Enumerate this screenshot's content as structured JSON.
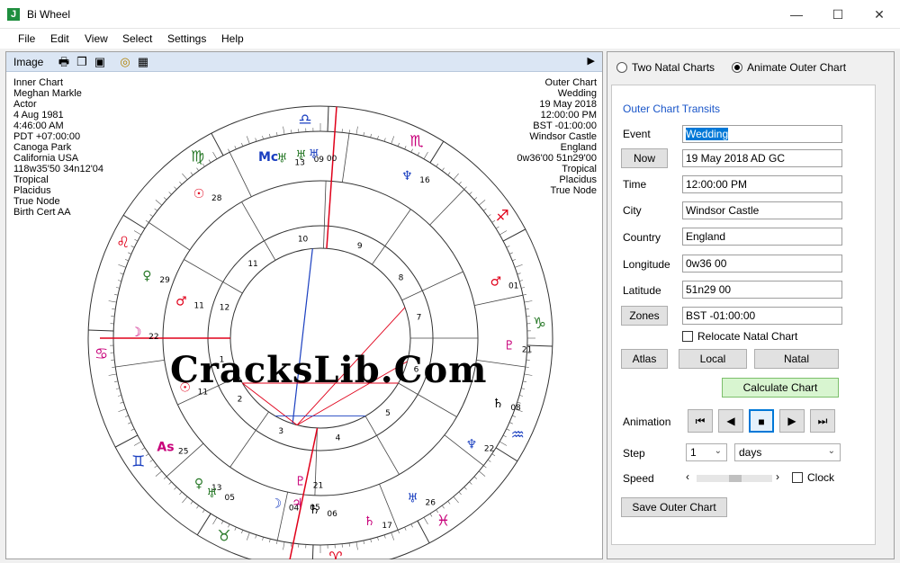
{
  "window": {
    "icon": "J",
    "title": "Bi Wheel",
    "minimize": "—",
    "maximize": "☐",
    "close": "✕"
  },
  "menu": [
    "File",
    "Edit",
    "View",
    "Select",
    "Settings",
    "Help"
  ],
  "toolbar": {
    "label": "Image",
    "icons": [
      "print-icon",
      "copy-icon",
      "save-image-icon",
      "target-icon",
      "grid-icon"
    ],
    "expand": "▶"
  },
  "inner_chart": [
    "Inner Chart",
    "Meghan Markle",
    "Actor",
    "4 Aug 1981",
    "4:46:00 AM",
    "PDT +07:00:00",
    "Canoga Park",
    "California USA",
    "118w35'50 34n12'04",
    "Tropical",
    "Placidus",
    "True Node",
    "Birth Cert AA"
  ],
  "outer_chart": [
    "Outer Chart",
    "Wedding",
    "19 May 2018",
    "12:00:00 PM",
    "BST -01:00:00",
    "Windsor Castle",
    "England",
    "0w36'00 51n29'00",
    "Tropical",
    "Placidus",
    "True Node"
  ],
  "watermark": "CracksLib.Com",
  "wheel": {
    "signs": [
      "♈",
      "♉",
      "♊",
      "♋",
      "♌",
      "♍",
      "♎",
      "♏",
      "♐",
      "♑",
      "♒",
      "♓"
    ],
    "sign_colors": [
      "#e0001a",
      "#2a7a2a",
      "#1a3fc0",
      "#c8007a",
      "#e0001a",
      "#2a7a2a",
      "#1a3fc0",
      "#c8007a",
      "#e0001a",
      "#2a7a2a",
      "#1a3fc0",
      "#c8007a"
    ],
    "inner_house_numbers": [
      "1",
      "2",
      "3",
      "4",
      "5",
      "6",
      "7",
      "8",
      "9",
      "10",
      "11",
      "12"
    ],
    "outer_planets": [
      {
        "glyph": "♅",
        "deg": "13",
        "color": "#2a7a2a"
      },
      {
        "glyph": "♅",
        "deg": "09",
        "color": "#2a7a2a"
      },
      {
        "glyph": "♅",
        "deg": "00",
        "color": "#1a3fc0"
      },
      {
        "glyph": "Mc",
        "deg": "",
        "color": "#1a3fc0"
      },
      {
        "glyph": "♆",
        "deg": "16",
        "color": "#1a3fc0"
      },
      {
        "glyph": "☉",
        "deg": "28",
        "color": "#e0001a"
      },
      {
        "glyph": "♀",
        "deg": "29",
        "color": "#2a7a2a"
      },
      {
        "glyph": "♂",
        "deg": "11",
        "color": "#e0001a"
      },
      {
        "glyph": "☽",
        "deg": "22",
        "color": "#c8007a"
      },
      {
        "glyph": "♂",
        "deg": "01",
        "color": "#e0001a"
      },
      {
        "glyph": "♇",
        "deg": "21",
        "color": "#c8007a"
      },
      {
        "glyph": "♄",
        "deg": "08",
        "color": "#000000"
      },
      {
        "glyph": "♆",
        "deg": "22",
        "color": "#1a3fc0"
      },
      {
        "glyph": "♅",
        "deg": "26",
        "color": "#1a3fc0"
      },
      {
        "glyph": "♄",
        "deg": "17",
        "color": "#c8007a"
      },
      {
        "glyph": "♀",
        "deg": "13",
        "color": "#2a7a2a"
      },
      {
        "glyph": "☽",
        "deg": "04",
        "color": "#1a3fc0"
      },
      {
        "glyph": "♃",
        "deg": "05",
        "color": "#c8007a"
      },
      {
        "glyph": "♄",
        "deg": "06",
        "color": "#000000"
      },
      {
        "glyph": "♇",
        "deg": "21",
        "color": "#c8007a"
      },
      {
        "glyph": "♅",
        "deg": "05",
        "color": "#2a7a2a"
      },
      {
        "glyph": "☉",
        "deg": "11",
        "color": "#e0001a"
      },
      {
        "glyph": "As",
        "deg": "25",
        "color": "#c8007a"
      }
    ]
  },
  "right": {
    "radio_two": "Two Natal Charts",
    "radio_animate": "Animate Outer Chart",
    "group_title": "Outer Chart Transits",
    "event_label": "Event",
    "event_value": "Wedding",
    "now_button": "Now",
    "date_value": "19 May 2018 AD GC",
    "time_label": "Time",
    "time_value": "12:00:00 PM",
    "city_label": "City",
    "city_value": "Windsor Castle",
    "country_label": "Country",
    "country_value": "England",
    "longitude_label": "Longitude",
    "longitude_value": "0w36 00",
    "latitude_label": "Latitude",
    "latitude_value": "51n29 00",
    "zones_button": "Zones",
    "zones_value": "BST -01:00:00",
    "relocate_label": "Relocate Natal Chart",
    "atlas_button": "Atlas",
    "local_button": "Local",
    "natal_button": "Natal",
    "calculate_button": "Calculate Chart",
    "animation_label": "Animation",
    "anim_buttons": [
      "⏮",
      "◀",
      "■",
      "▶",
      "⏭"
    ],
    "step_label": "Step",
    "step_value": "1",
    "step_unit": "days",
    "speed_label": "Speed",
    "speed_left": "‹",
    "speed_right": "›",
    "clock_label": "Clock",
    "save_button": "Save Outer Chart"
  }
}
